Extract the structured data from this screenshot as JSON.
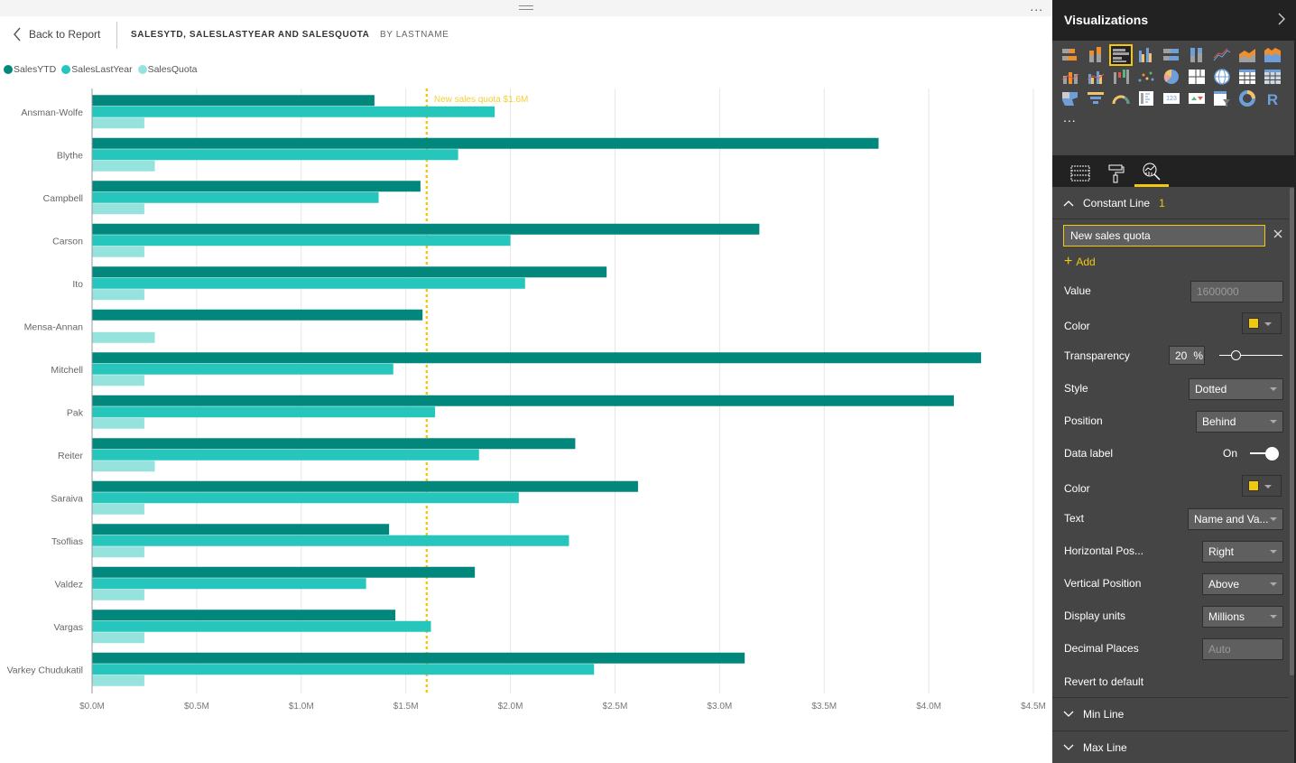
{
  "header": {
    "back_label": "Back to Report",
    "title": "SALESYTD, SALESLASTYEAR AND SALESQUOTA",
    "subtitle": "BY LASTNAME",
    "more_label": "..."
  },
  "legend": [
    {
      "label": "SalesYTD",
      "color": "#01877c"
    },
    {
      "label": "SalesLastYear",
      "color": "#26c6bd"
    },
    {
      "label": "SalesQuota",
      "color": "#96e3dd"
    }
  ],
  "chart_data": {
    "type": "bar",
    "orientation": "horizontal",
    "title": "SalesYTD, SalesLastYear and SalesQuota by LastName",
    "xlabel": "",
    "ylabel": "",
    "xlim": [
      0,
      4500000
    ],
    "x_ticks": [
      0,
      500000,
      1000000,
      1500000,
      2000000,
      2500000,
      3000000,
      3500000,
      4000000,
      4500000
    ],
    "x_tick_labels": [
      "$0.0M",
      "$0.5M",
      "$1.0M",
      "$1.5M",
      "$2.0M",
      "$2.5M",
      "$3.0M",
      "$3.5M",
      "$4.0M",
      "$4.5M"
    ],
    "grid": true,
    "legend_position": "top-left",
    "categories": [
      "Ansman-Wolfe",
      "Blythe",
      "Campbell",
      "Carson",
      "Ito",
      "Mensa-Annan",
      "Mitchell",
      "Pak",
      "Reiter",
      "Saraiva",
      "Tsoflias",
      "Valdez",
      "Vargas",
      "Varkey Chudukatil"
    ],
    "series": [
      {
        "name": "SalesYTD",
        "color": "#01877c",
        "values": [
          1350000,
          3760000,
          1570000,
          3190000,
          2460000,
          1580000,
          4250000,
          4120000,
          2310000,
          2610000,
          1420000,
          1830000,
          1450000,
          3120000
        ]
      },
      {
        "name": "SalesLastYear",
        "color": "#26c6bd",
        "values": [
          1925000,
          1750000,
          1370000,
          2000000,
          2070000,
          null,
          1440000,
          1640000,
          1850000,
          2040000,
          2280000,
          1310000,
          1620000,
          2400000
        ]
      },
      {
        "name": "SalesQuota",
        "color": "#96e3dd",
        "values": [
          250000,
          300000,
          250000,
          250000,
          250000,
          300000,
          250000,
          250000,
          300000,
          250000,
          250000,
          250000,
          250000,
          250000
        ]
      }
    ],
    "constant_line": {
      "name": "New sales quota",
      "value": 1600000,
      "label": "New sales quota $1.6M",
      "color": "#f2c811",
      "style": "dotted"
    }
  },
  "panel": {
    "title": "Visualizations",
    "viz_icons": [
      "stacked-bar-chart",
      "stacked-column-chart",
      "clustered-bar-chart",
      "clustered-column-chart",
      "100-stacked-bar-chart",
      "100-stacked-column-chart",
      "line-chart",
      "area-chart",
      "stacked-area-chart",
      "line-and-stacked-column-chart",
      "line-and-clustered-column-chart",
      "waterfall-chart",
      "scatter-chart",
      "pie-chart",
      "treemap",
      "map",
      "table",
      "matrix",
      "filled-map",
      "funnel",
      "gauge",
      "multi-row-card",
      "card",
      "kpi",
      "slicer",
      "donut-chart",
      "r-script-visual"
    ],
    "selected_viz": "clustered-bar-chart",
    "more_label": "...",
    "tabs": [
      {
        "name": "fields-tab"
      },
      {
        "name": "format-tab"
      },
      {
        "name": "analytics-tab",
        "active": true
      }
    ],
    "constant_line": {
      "section_label": "Constant Line",
      "count": "1",
      "name_value": "New sales quota",
      "add_label": "Add",
      "value_label": "Value",
      "value": "1600000",
      "color_label": "Color",
      "color": "#f2c811",
      "transparency_label": "Transparency",
      "transparency": "20",
      "transparency_unit": "%",
      "transparency_pct": 20,
      "style_label": "Style",
      "style_value": "Dotted",
      "position_label": "Position",
      "position_value": "Behind",
      "data_label_label": "Data label",
      "data_label_state": "On",
      "label_color_label": "Color",
      "label_color": "#f2c811",
      "text_label": "Text",
      "text_value": "Name and Va...",
      "hpos_label": "Horizontal Pos...",
      "hpos_value": "Right",
      "vpos_label": "Vertical Position",
      "vpos_value": "Above",
      "units_label": "Display units",
      "units_value": "Millions",
      "decimals_label": "Decimal Places",
      "decimals_placeholder": "Auto",
      "revert_label": "Revert to default"
    },
    "min_line_label": "Min Line",
    "max_line_label": "Max Line"
  }
}
